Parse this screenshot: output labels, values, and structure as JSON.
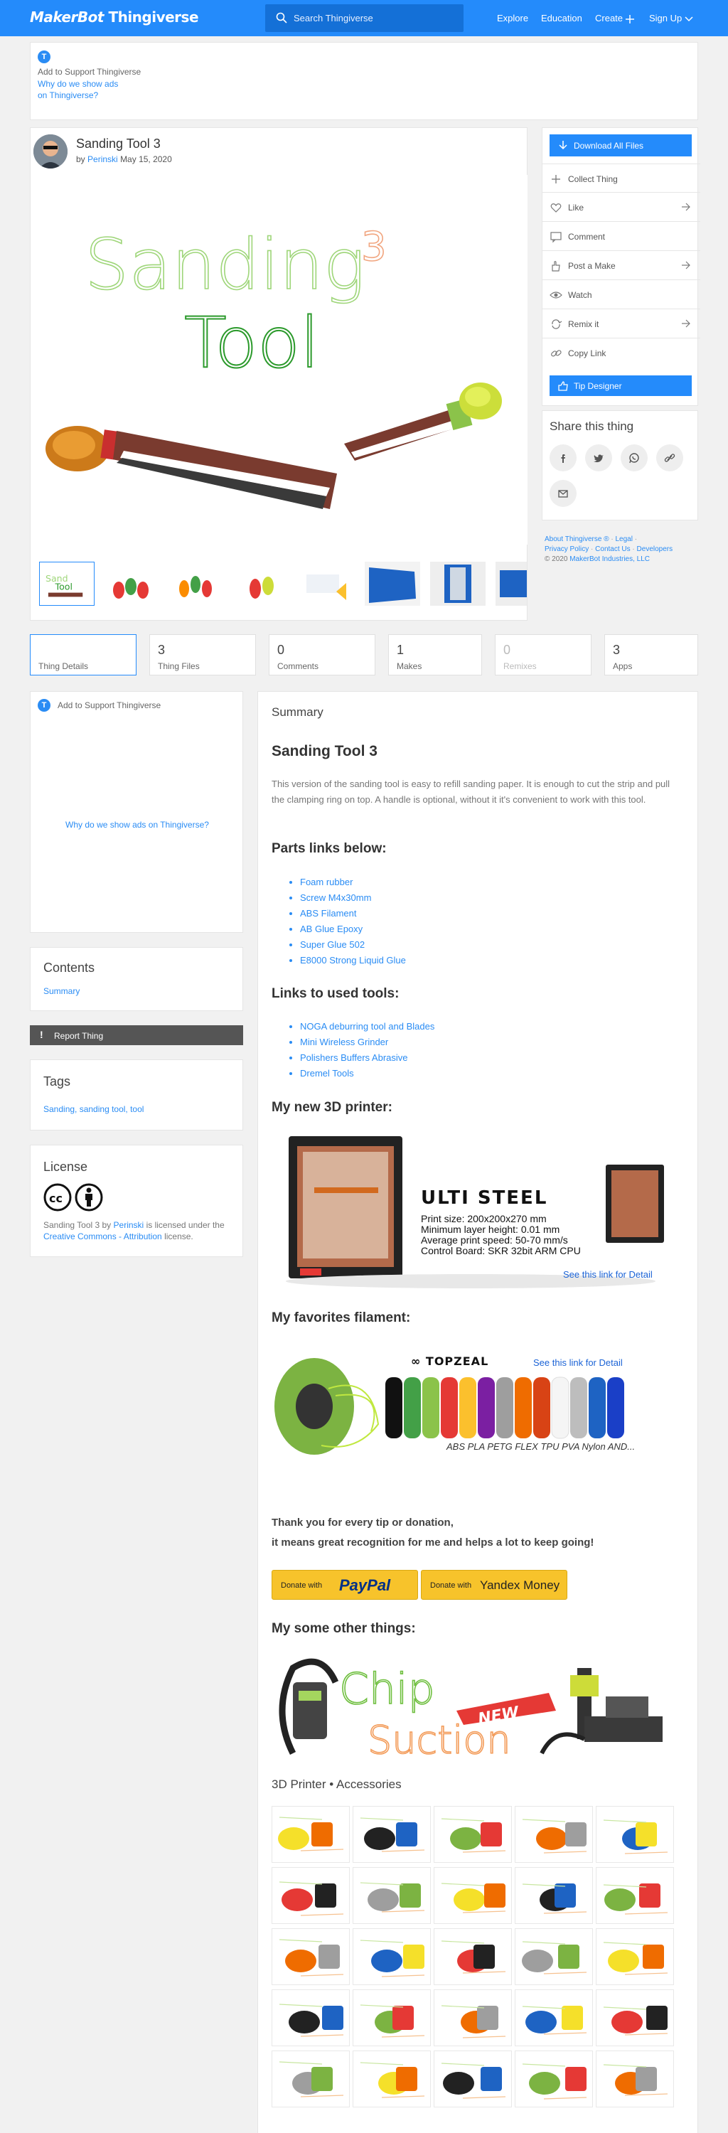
{
  "nav": {
    "logo_a": "MakerBot",
    "logo_b": "Thingiverse",
    "search_placeholder": "Search Thingiverse",
    "explore": "Explore",
    "education": "Education",
    "create": "Create",
    "signup": "Sign Up"
  },
  "ad_top": {
    "support": "Add to Support Thingiverse",
    "why_1": "Why do we show ads",
    "why_2": "on Thingiverse?"
  },
  "thing": {
    "title": "Sanding Tool 3",
    "by": "by",
    "author": "Perinski",
    "date": "May 15, 2020",
    "hero_word1": "Sanding",
    "hero_word2": "Tool",
    "hero_num": "3"
  },
  "actions": {
    "download": "Download All Files",
    "collect": "Collect Thing",
    "like": "Like",
    "comment": "Comment",
    "post_make": "Post a Make",
    "watch": "Watch",
    "remix": "Remix it",
    "copy_link": "Copy Link",
    "tip": "Tip Designer"
  },
  "share": {
    "title": "Share this thing"
  },
  "footer_links": {
    "about": "About Thingiverse ®",
    "legal": "Legal",
    "privacy": "Privacy Policy",
    "contact": "Contact Us",
    "developers": "Developers",
    "copyright": "© 2020",
    "company": "MakerBot Industries, LLC"
  },
  "tabs": [
    {
      "num": "",
      "label": "Thing Details"
    },
    {
      "num": "3",
      "label": "Thing Files"
    },
    {
      "num": "0",
      "label": "Comments"
    },
    {
      "num": "1",
      "label": "Makes"
    },
    {
      "num": "0",
      "label": "Remixes"
    },
    {
      "num": "3",
      "label": "Apps"
    }
  ],
  "ad_side": {
    "support": "Add to Support Thingiverse",
    "why": "Why do we show ads on Thingiverse?"
  },
  "contents": {
    "title": "Contents",
    "summary": "Summary"
  },
  "report": "Report Thing",
  "tags": {
    "title": "Tags",
    "list": "Sanding, sanding tool, tool"
  },
  "license": {
    "title": "License",
    "text_1": "Sanding Tool 3 by",
    "author": "Perinski",
    "text_2": "is licensed under the",
    "link": "Creative Commons - Attribution",
    "text_3": "license."
  },
  "summary": {
    "label": "Summary",
    "heading": "Sanding Tool 3",
    "body": "This version of the sanding tool is easy to refill sanding paper. It is enough to cut the strip and pull the clamping ring on top. A handle is optional, without it it's convenient to work with this tool.",
    "parts_heading": "Parts links below:",
    "parts": [
      "Foam rubber",
      "Screw M4x30mm",
      "ABS Filament",
      "AB Glue Epoxy",
      "Super Glue 502",
      "E8000 Strong Liquid Glue"
    ],
    "tools_heading": "Links to used tools:",
    "tools": [
      "NOGA deburring tool and Blades",
      "Mini Wireless Grinder",
      "Polishers Buffers Abrasive",
      "Dremel Tools"
    ],
    "printer_heading": "My new 3D printer:",
    "printer_name": "ULTI STEEL",
    "printer_specs": [
      "Print size: 200x200x270 mm",
      "Minimum layer height: 0.01 mm",
      "Average print speed: 50-70 mm/s",
      "Control Board: SKR 32bit ARM CPU"
    ],
    "printer_link": "See this link for Detail",
    "filament_heading": "My favorites filament:",
    "filament_brand": "TOPZEAL",
    "filament_link": "See this link for Detail",
    "filament_types": "ABS PLA PETG FLEX TPU PVA Nylon AND...",
    "thanks_1": "Thank you for every tip or donation,",
    "thanks_2": "it means great recognition for me and helps a lot to keep going!",
    "donate_pp_a": "Donate with",
    "donate_pp_b": "PayPal",
    "donate_ym_a": "Donate with",
    "donate_ym_b": "Yandex Money",
    "other_heading": "My some other things:",
    "banner_w1": "Chip",
    "banner_w2": "Suction",
    "banner_new": "NEW",
    "accessories": "3D Printer • Accessories"
  },
  "colors": {
    "brand_blue": "#248bfb",
    "link_blue": "#2a8cf4",
    "donate_yellow": "#f7c32b",
    "report_gray": "#555555"
  }
}
